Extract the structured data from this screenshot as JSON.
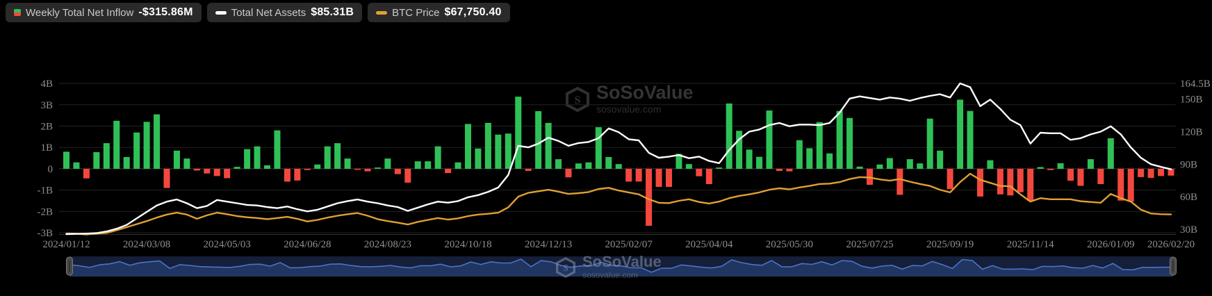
{
  "legend": {
    "items": [
      {
        "label": "Weekly Total Net Inflow",
        "value": "-$315.86M",
        "icon": "inflow-updown-icon",
        "icon_colors": [
          "#2fc157",
          "#f4483e"
        ]
      },
      {
        "label": "Total Net Assets",
        "value": "$85.31B",
        "icon": "dash-icon",
        "color": "#ffffff"
      },
      {
        "label": "BTC Price",
        "value": "$67,750.40",
        "icon": "dash-icon",
        "color": "#e0a032"
      }
    ]
  },
  "watermark": {
    "brand": "SoSoValue",
    "domain": "sosovalue.com"
  },
  "colors": {
    "background": "#000000",
    "chip_bg": "#2a2a2a",
    "bar_positive": "#2fc157",
    "bar_negative": "#f4483e",
    "assets_line": "#ffffff",
    "btc_line": "#e0a032",
    "grid": "#222222",
    "zero_line": "#3a3a3a",
    "axis_line": "#333333",
    "axis_text": "#8f8f8f",
    "nav_track": "#151f39",
    "nav_fill": "#203560",
    "nav_line": "#4a74c9",
    "nav_handle": "#4a4a4a",
    "nav_handle_border": "#787878"
  },
  "chart_data": {
    "type": "bar+line combo with range navigator",
    "title": "Bitcoin Spot ETF Weekly Total Net Inflow vs Total Net Assets and BTC Price",
    "x_is_weekly": true,
    "x_tick_labels": [
      "2024/01/12",
      "2024/03/08",
      "2024/05/03",
      "2024/06/28",
      "2024/08/23",
      "2024/10/18",
      "2024/12/13",
      "2025/02/07",
      "2025/04/04",
      "2025/05/30",
      "2025/07/25",
      "2025/09/19",
      "2025/11/14",
      "2026/01/09",
      "2026/02/20"
    ],
    "x_tick_week_index": [
      0,
      8,
      16,
      24,
      32,
      40,
      48,
      56,
      64,
      72,
      80,
      88,
      96,
      104,
      110
    ],
    "left_axis": {
      "tick_labels": [
        "4B",
        "3B",
        "2B",
        "1B",
        "0",
        "-1B",
        "-2B",
        "-3B"
      ],
      "tick_values": [
        4,
        3,
        2,
        1,
        0,
        -1,
        -2,
        -3
      ],
      "min": -3,
      "max": 4,
      "unit": "USD billions",
      "grid": true
    },
    "right_axis": {
      "tick_labels": [
        "164.5B",
        "150B",
        "120B",
        "90B",
        "60B",
        "30B"
      ],
      "tick_values": [
        164.5,
        150,
        120,
        90,
        60,
        30
      ],
      "max": 164.5,
      "unit": "USD billions",
      "grid": false
    },
    "series": [
      {
        "name": "Weekly Total Net Inflow",
        "type": "bar",
        "axis": "left",
        "unit": "B USD",
        "last_value_label": "-$315.86M",
        "values": [
          0.8,
          0.3,
          -0.45,
          0.78,
          1.2,
          2.25,
          0.55,
          1.7,
          2.2,
          2.55,
          -0.9,
          0.85,
          0.48,
          -0.08,
          -0.22,
          -0.34,
          -0.44,
          0.09,
          0.92,
          1.05,
          0.16,
          1.8,
          -0.6,
          -0.55,
          -0.06,
          0.2,
          1.05,
          1.2,
          0.48,
          -0.05,
          -0.12,
          0.06,
          0.48,
          -0.25,
          -0.65,
          0.35,
          0.35,
          1.05,
          -0.2,
          0.3,
          2.1,
          0.95,
          2.15,
          1.6,
          1.65,
          3.38,
          -0.1,
          2.7,
          2.15,
          0.45,
          -0.4,
          0.25,
          0.3,
          1.95,
          0.55,
          0.22,
          -0.6,
          -0.6,
          -2.67,
          -0.85,
          -0.85,
          0.7,
          0.22,
          -0.35,
          -0.72,
          0.06,
          3.06,
          1.78,
          0.9,
          0.56,
          2.73,
          -0.1,
          -0.12,
          1.34,
          0.96,
          2.19,
          0.72,
          2.71,
          2.38,
          0.1,
          -0.75,
          0.2,
          0.5,
          -1.22,
          0.45,
          0.25,
          2.35,
          0.85,
          -0.95,
          3.24,
          2.71,
          -1.3,
          0.4,
          -1.2,
          -1.25,
          -1.1,
          -1.5,
          0.08,
          -0.06,
          0.26,
          -0.56,
          -0.8,
          0.45,
          -0.72,
          1.43,
          -1.49,
          -1.54,
          -0.39,
          -0.43,
          -0.34,
          -0.32
        ]
      },
      {
        "name": "Total Net Assets",
        "type": "line",
        "axis": "right",
        "unit": "B USD",
        "last_value_label": "$85.31B",
        "values": [
          25.5,
          25.8,
          26.0,
          26.5,
          28.0,
          30.5,
          34.0,
          40.0,
          46.0,
          52.0,
          55.5,
          57.5,
          54.0,
          49.5,
          51.5,
          57.0,
          55.5,
          54.0,
          52.5,
          52.0,
          50.5,
          49.5,
          51.0,
          48.5,
          46.5,
          48.0,
          51.0,
          54.0,
          56.0,
          57.5,
          55.5,
          54.0,
          52.0,
          50.5,
          47.0,
          50.0,
          53.0,
          55.5,
          54.5,
          56.0,
          59.5,
          61.5,
          64.5,
          68.5,
          80.0,
          107.0,
          105.5,
          109.0,
          114.5,
          111.5,
          107.0,
          109.5,
          110.5,
          114.0,
          123.0,
          119.5,
          113.0,
          112.0,
          100.5,
          96.0,
          97.0,
          98.5,
          95.5,
          97.0,
          93.0,
          91.0,
          103.0,
          113.0,
          120.0,
          122.0,
          126.0,
          128.0,
          125.0,
          126.5,
          126.5,
          126.0,
          128.0,
          137.5,
          150.5,
          152.5,
          151.0,
          149.5,
          151.5,
          150.5,
          148.5,
          151.0,
          153.0,
          154.5,
          151.5,
          164.5,
          161.0,
          143.5,
          149.5,
          141.0,
          131.0,
          126.0,
          109.0,
          119.0,
          118.5,
          118.5,
          112.5,
          114.0,
          117.5,
          120.0,
          125.0,
          117.5,
          105.5,
          96.0,
          90.0,
          87.5,
          85.31
        ]
      },
      {
        "name": "BTC Price",
        "type": "line",
        "axis": "hidden",
        "unit": "USD",
        "last_value_label": "$67,750.40",
        "values": [
          42800,
          42500,
          41500,
          42500,
          43500,
          47000,
          51000,
          55000,
          59000,
          63500,
          67500,
          70000,
          67500,
          62000,
          66500,
          70000,
          68000,
          65500,
          64000,
          63000,
          61500,
          63000,
          64500,
          62000,
          58500,
          60500,
          63500,
          66000,
          68000,
          69500,
          66000,
          61500,
          59000,
          57000,
          54500,
          58000,
          60500,
          63000,
          61000,
          62500,
          65500,
          67500,
          68500,
          70000,
          77000,
          91000,
          96000,
          98000,
          100000,
          97500,
          94500,
          95500,
          97000,
          101000,
          102500,
          99000,
          96500,
          94000,
          87500,
          83000,
          82500,
          85500,
          87500,
          84000,
          82000,
          84500,
          89000,
          92000,
          94000,
          96500,
          100000,
          102000,
          100500,
          103000,
          105000,
          107500,
          108000,
          110000,
          114000,
          116500,
          116000,
          113500,
          112000,
          114000,
          110500,
          107500,
          105000,
          100000,
          96500,
          110000,
          121000,
          113000,
          109000,
          105000,
          104500,
          94000,
          84500,
          89000,
          87500,
          87500,
          87500,
          85000,
          84000,
          83000,
          94500,
          89000,
          84500,
          74000,
          69000,
          68000,
          67750
        ]
      }
    ],
    "navigator": {
      "shows": "Weekly Total Net Inflow mini area chart",
      "range_start_label": "2024/01/12",
      "range_end_label": "2026/02/20"
    }
  }
}
